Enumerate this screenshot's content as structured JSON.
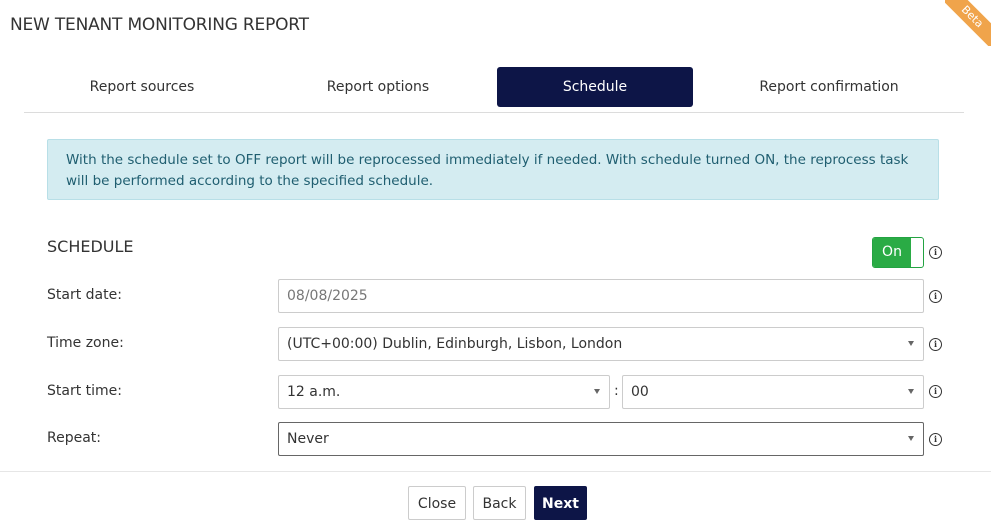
{
  "page": {
    "title": "NEW TENANT MONITORING REPORT",
    "beta_label": "Beta"
  },
  "tabs": [
    {
      "label": "Report sources",
      "active": false
    },
    {
      "label": "Report options",
      "active": false
    },
    {
      "label": "Schedule",
      "active": true
    },
    {
      "label": "Report confirmation",
      "active": false
    }
  ],
  "alert": {
    "text": "With the schedule set to OFF report will be reprocessed immediately if needed. With schedule turned ON, the reprocess task will be performed according to the specified schedule."
  },
  "schedule": {
    "section_title": "SCHEDULE",
    "toggle_label": "On",
    "toggle_state": "on",
    "start_date": {
      "label": "Start date:",
      "value": "08/08/2025"
    },
    "time_zone": {
      "label": "Time zone:",
      "value": "(UTC+00:00) Dublin, Edinburgh, Lisbon, London"
    },
    "start_time": {
      "label": "Start time:",
      "hour": "12 a.m.",
      "separator": ":",
      "minute": "00"
    },
    "repeat": {
      "label": "Repeat:",
      "value": "Never"
    }
  },
  "footer": {
    "close_label": "Close",
    "back_label": "Back",
    "next_label": "Next"
  },
  "colors": {
    "primary_navy": "#0d1547",
    "toggle_green": "#2aab45",
    "alert_bg": "#d4ecf1",
    "beta_orange": "#f0a44b"
  },
  "icons": [
    "info-icon",
    "chevron-down-icon"
  ]
}
